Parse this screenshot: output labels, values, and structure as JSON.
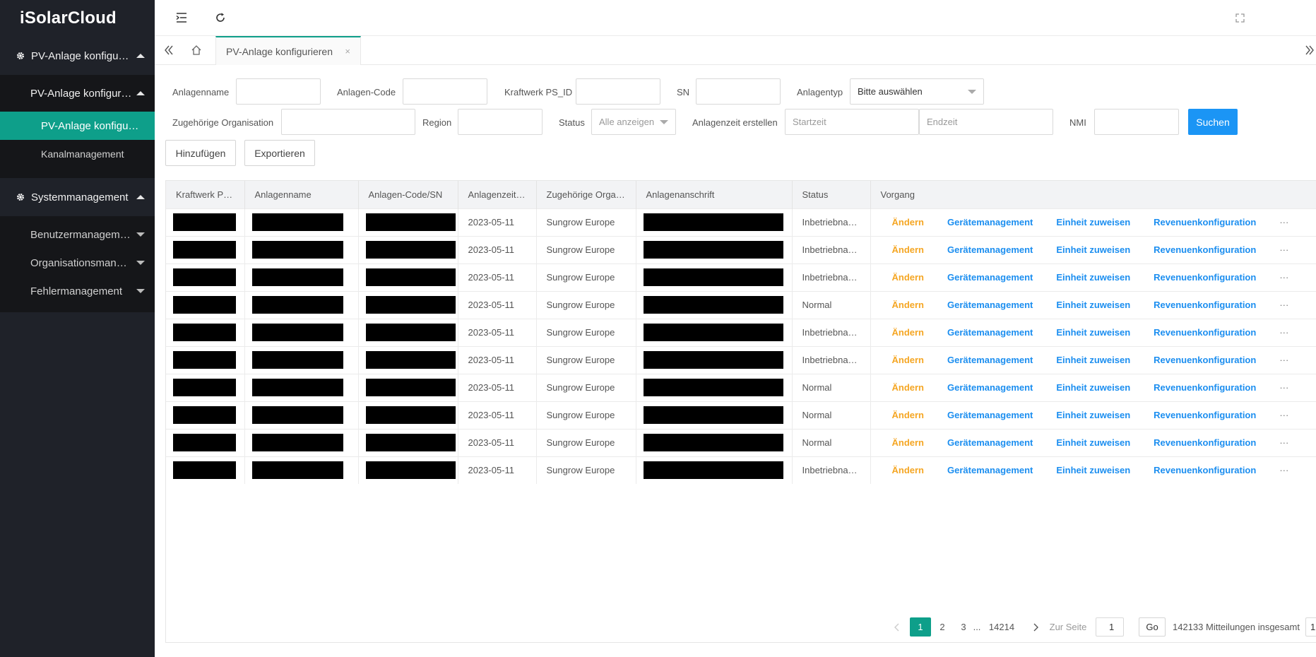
{
  "app": {
    "logo": "iSolarCloud"
  },
  "sidebar": {
    "group1": {
      "label": "PV-Anlage konfigurie…"
    },
    "group1_sub": {
      "label": "PV-Anlage konfigurie…"
    },
    "leaf_active": "PV-Anlage konfigu…",
    "leaf_channel": "Kanalmanagement",
    "group2": {
      "label": "Systemmanagement"
    },
    "sys_items": [
      "Benutzermanagement",
      "Organisationsmanag…",
      "Fehlermanagement"
    ]
  },
  "tabs": {
    "active": "PV-Anlage konfigurieren",
    "close": "×"
  },
  "filters": {
    "anlagenname": "Anlagenname",
    "anlagen_code": "Anlagen-Code",
    "ps_id": "Kraftwerk PS_ID",
    "sn": "SN",
    "anlagentyp": "Anlagentyp",
    "anlagentyp_value": "Bitte auswählen",
    "organisation": "Zugehörige Organisation",
    "region": "Region",
    "status": "Status",
    "status_value": "Alle anzeigen",
    "zeit": "Anlagenzeit erstellen",
    "start_placeholder": "Startzeit",
    "end_placeholder": "Endzeit",
    "nmi": "NMI",
    "search_btn": "Suchen",
    "add_btn": "Hinzufügen",
    "export_btn": "Exportieren"
  },
  "table": {
    "headers": [
      "Kraftwerk P…",
      "Anlagenname",
      "Anlagen-Code/SN",
      "Anlagenzeit…",
      "Zugehörige Orga…",
      "Anlagenanschrift",
      "Status",
      "Vorgang"
    ],
    "actions": {
      "edit": "Ändern",
      "devices": "Gerätemanagement",
      "assign": "Einheit zuweisen",
      "revenue": "Revenuenkonfiguration",
      "more": "···"
    },
    "rows": [
      {
        "date": "2023-05-11",
        "org": "Sungrow Europe",
        "status": "Inbetriebna…"
      },
      {
        "date": "2023-05-11",
        "org": "Sungrow Europe",
        "status": "Inbetriebna…"
      },
      {
        "date": "2023-05-11",
        "org": "Sungrow Europe",
        "status": "Inbetriebna…"
      },
      {
        "date": "2023-05-11",
        "org": "Sungrow Europe",
        "status": "Normal"
      },
      {
        "date": "2023-05-11",
        "org": "Sungrow Europe",
        "status": "Inbetriebna…"
      },
      {
        "date": "2023-05-11",
        "org": "Sungrow Europe",
        "status": "Inbetriebna…"
      },
      {
        "date": "2023-05-11",
        "org": "Sungrow Europe",
        "status": "Normal"
      },
      {
        "date": "2023-05-11",
        "org": "Sungrow Europe",
        "status": "Normal"
      },
      {
        "date": "2023-05-11",
        "org": "Sungrow Europe",
        "status": "Normal"
      },
      {
        "date": "2023-05-11",
        "org": "Sungrow Europe",
        "status": "Inbetriebna…"
      }
    ]
  },
  "pagination": {
    "pages": [
      "1",
      "2",
      "3"
    ],
    "ellipsis": "...",
    "last": "14214",
    "goto_label": "Zur Seite",
    "goto_value": "1",
    "go_btn": "Go",
    "total": "142133 Mitteilungen insgesamt",
    "page_size_peek": "1"
  },
  "colors": {
    "accent": "#0e9f8a",
    "primary": "#1b95f5",
    "warn": "#f5a623",
    "sidebar": "#1f2229"
  }
}
